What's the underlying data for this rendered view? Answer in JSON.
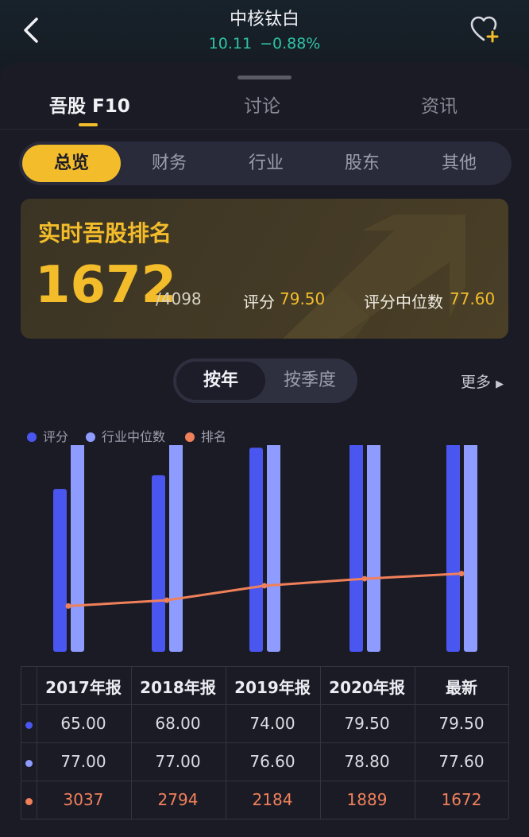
{
  "header": {
    "title": "中核钛白",
    "price": "10.11",
    "change": "−0.88%"
  },
  "tabs": [
    {
      "label": "吾股 F10",
      "active": true
    },
    {
      "label": "讨论",
      "active": false
    },
    {
      "label": "资讯",
      "active": false
    }
  ],
  "sub_tabs": [
    {
      "label": "总览",
      "active": true
    },
    {
      "label": "财务",
      "active": false
    },
    {
      "label": "行业",
      "active": false
    },
    {
      "label": "股东",
      "active": false
    },
    {
      "label": "其他",
      "active": false
    }
  ],
  "rank": {
    "title": "实时吾股排名",
    "value": "1672",
    "total": "/4098",
    "score_label": "评分",
    "score": "79.50",
    "median_label": "评分中位数",
    "median": "77.60"
  },
  "period_toggle": {
    "yearly": "按年",
    "quarterly": "按季度",
    "selected": "按年"
  },
  "more_label": "更多",
  "colors": {
    "accent": "#f3bc2b",
    "score": "#4a56f0",
    "median": "#8e9cff",
    "rank": "#f0805a",
    "quote": "#2fc3a6"
  },
  "chart_data": {
    "type": "bar",
    "categories": [
      "2017年报",
      "2018年报",
      "2019年报",
      "2020年报",
      "最新"
    ],
    "series": [
      {
        "name": "评分",
        "type": "bar",
        "values": [
          65.0,
          68.0,
          74.0,
          79.5,
          79.5
        ]
      },
      {
        "name": "行业中位数",
        "type": "bar",
        "values": [
          77.0,
          77.0,
          76.6,
          78.8,
          77.6
        ]
      },
      {
        "name": "排名",
        "type": "line",
        "values": [
          3037,
          2794,
          2184,
          1889,
          1672
        ],
        "axis": "inverted"
      }
    ],
    "legend_position": "top-left",
    "grid": false
  },
  "table": {
    "headers": [
      "2017年报",
      "2018年报",
      "2019年报",
      "2020年报",
      "最新"
    ],
    "rows": [
      [
        "65.00",
        "68.00",
        "74.00",
        "79.50",
        "79.50"
      ],
      [
        "77.00",
        "77.00",
        "76.60",
        "78.80",
        "77.60"
      ],
      [
        "3037",
        "2794",
        "2184",
        "1889",
        "1672"
      ]
    ]
  }
}
